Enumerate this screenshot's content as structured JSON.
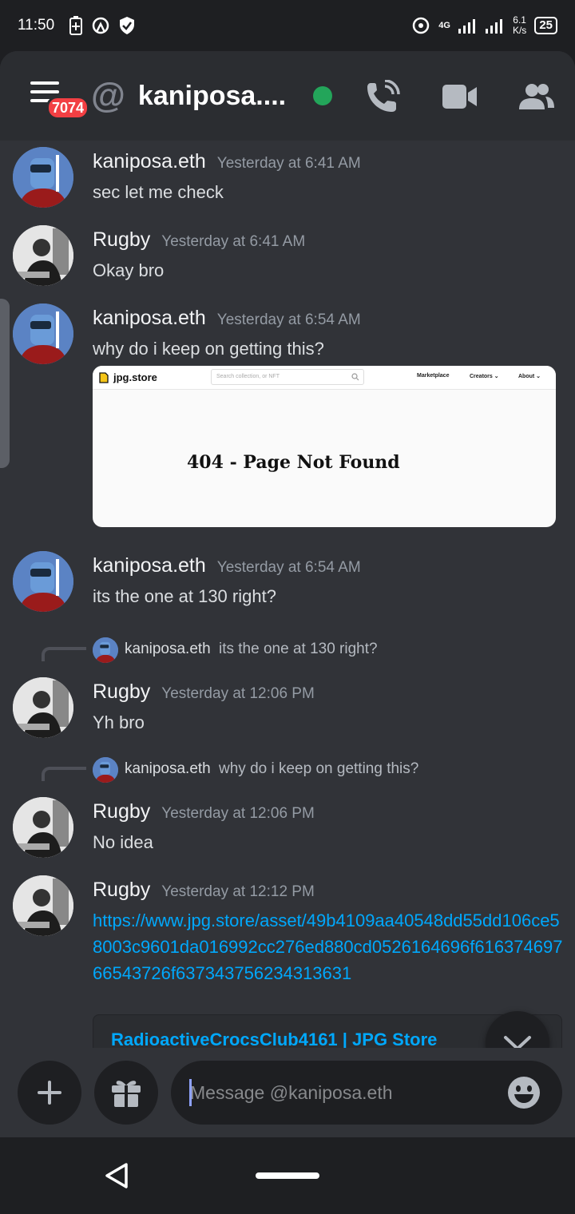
{
  "status_bar": {
    "time": "11:50",
    "network": "4G",
    "speed_value": "6.1",
    "speed_unit": "K/s",
    "battery": "25"
  },
  "header": {
    "badge_count": "7074",
    "title": "kaniposa....",
    "status_color": "#23a55a"
  },
  "messages": [
    {
      "author": "kaniposa.eth",
      "timestamp": "Yesterday at 6:41 AM",
      "text": "sec let me check"
    },
    {
      "author": "Rugby",
      "timestamp": "Yesterday at 6:41 AM",
      "text": "Okay bro"
    },
    {
      "author": "kaniposa.eth",
      "timestamp": "Yesterday at 6:54 AM",
      "text": "why do i keep on getting this?"
    },
    {
      "author": "kaniposa.eth",
      "timestamp": "Yesterday at 6:54 AM",
      "text": "its the one at 130 right?"
    },
    {
      "author": "Rugby",
      "timestamp": "Yesterday at 12:06 PM",
      "text": "Yh bro",
      "reply": {
        "author": "kaniposa.eth",
        "text": "its the one at 130 right?"
      }
    },
    {
      "author": "Rugby",
      "timestamp": "Yesterday at 12:06 PM",
      "text": "No idea",
      "reply": {
        "author": "kaniposa.eth",
        "text": "why do i keep on getting this?"
      }
    },
    {
      "author": "Rugby",
      "timestamp": "Yesterday at 12:12 PM",
      "link": "https://www.jpg.store/asset/49b4109aa40548dd55dd106ce58003c9601da016992cc276ed880cd0526164696f61637469766543726f637343756234313631"
    }
  ],
  "image_embed": {
    "site_name": "jpg.store",
    "search_placeholder": "Search collection, or NFT",
    "nav_marketplace": "Marketplace",
    "nav_creators": "Creators ⌄",
    "nav_about": "About ⌄",
    "error_text": "404 - Page Not Found"
  },
  "link_embed": {
    "title": "RadioactiveCrocsClub4161 | JPG Store"
  },
  "composer": {
    "placeholder": "Message @kaniposa.eth"
  },
  "colors": {
    "accent": "#00a8fc",
    "background": "#313338",
    "header": "#2b2d31",
    "badge": "#f23f43"
  }
}
